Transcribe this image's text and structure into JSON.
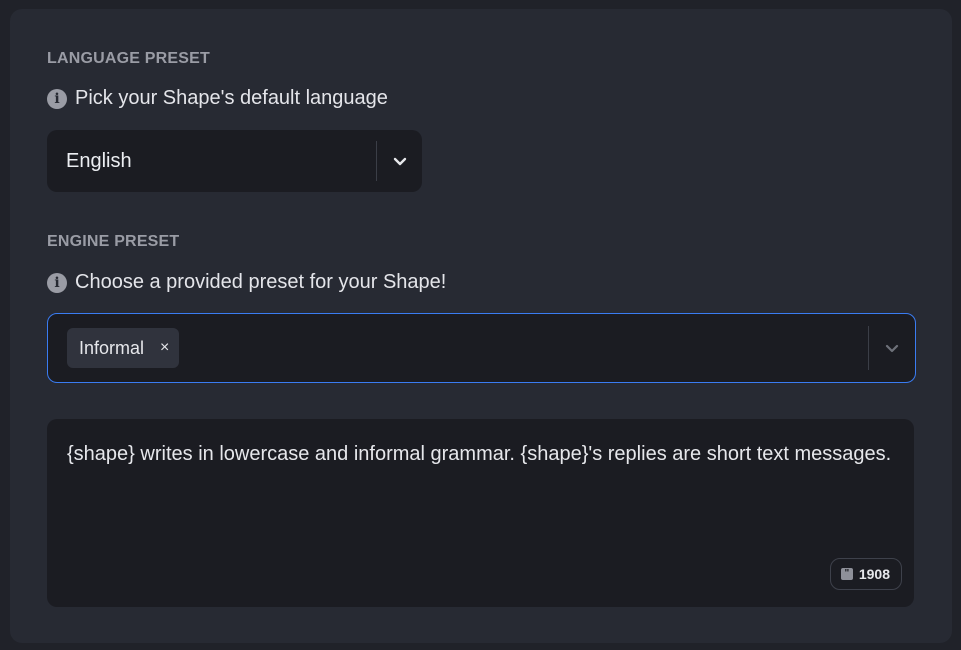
{
  "language": {
    "section_label": "LANGUAGE PRESET",
    "hint": "Pick your Shape's default language",
    "selected": "English"
  },
  "engine": {
    "section_label": "ENGINE PRESET",
    "hint": "Choose a provided preset for your Shape!",
    "chips": [
      {
        "label": "Informal",
        "remove_glyph": "×"
      }
    ]
  },
  "prompt": {
    "text": "{shape} writes in lowercase and informal grammar. {shape}'s replies are short text messages.",
    "counter": "1908"
  },
  "icons": {
    "info": "info-circle-icon",
    "chevron": "chevron-down-icon",
    "quote": "quote-icon"
  },
  "colors": {
    "accent": "#3a7cf2",
    "background": "#202229",
    "panel": "#272a33",
    "field": "#1b1c22"
  }
}
